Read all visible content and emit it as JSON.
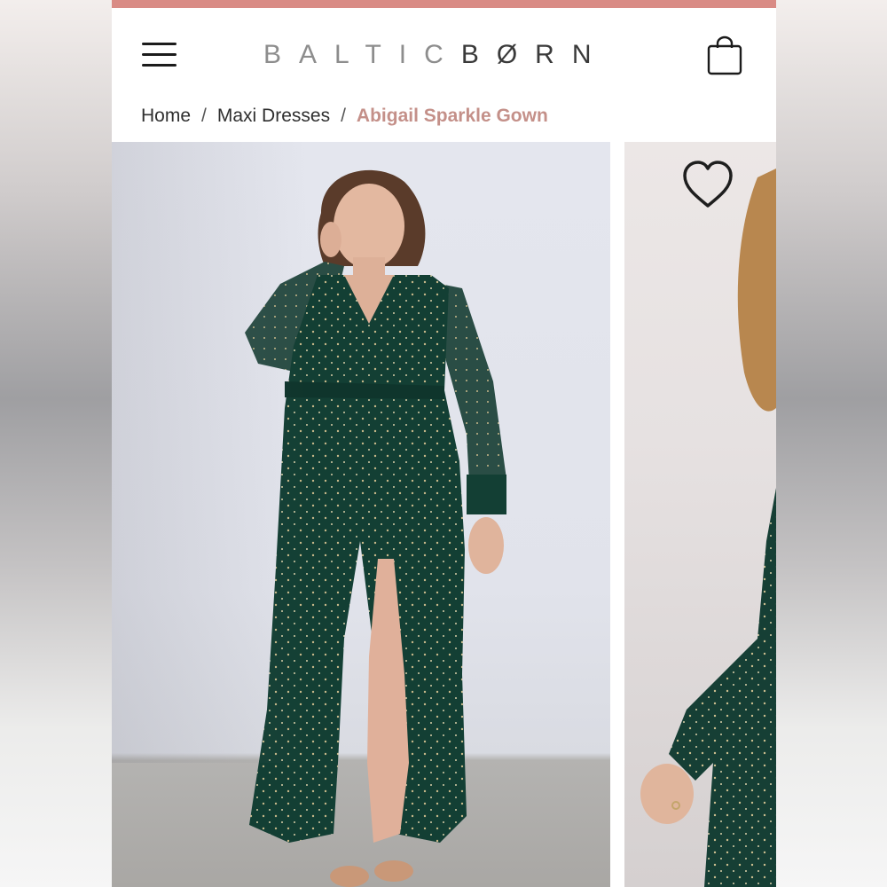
{
  "header": {
    "menu_icon": "hamburger-menu-icon",
    "brand_light": "BALTIC",
    "brand_dark": "BØRN",
    "cart_icon": "shopping-bag-icon"
  },
  "breadcrumb": {
    "items": [
      "Home",
      "Maxi Dresses"
    ],
    "separator": "/",
    "current": "Abigail Sparkle Gown"
  },
  "gallery": {
    "wishlist_icon": "heart-outline-icon",
    "product_color": "#123d33"
  },
  "colors": {
    "accent_strip": "#d98b85",
    "breadcrumb_current": "#c49089",
    "dress_green": "#123d33"
  }
}
